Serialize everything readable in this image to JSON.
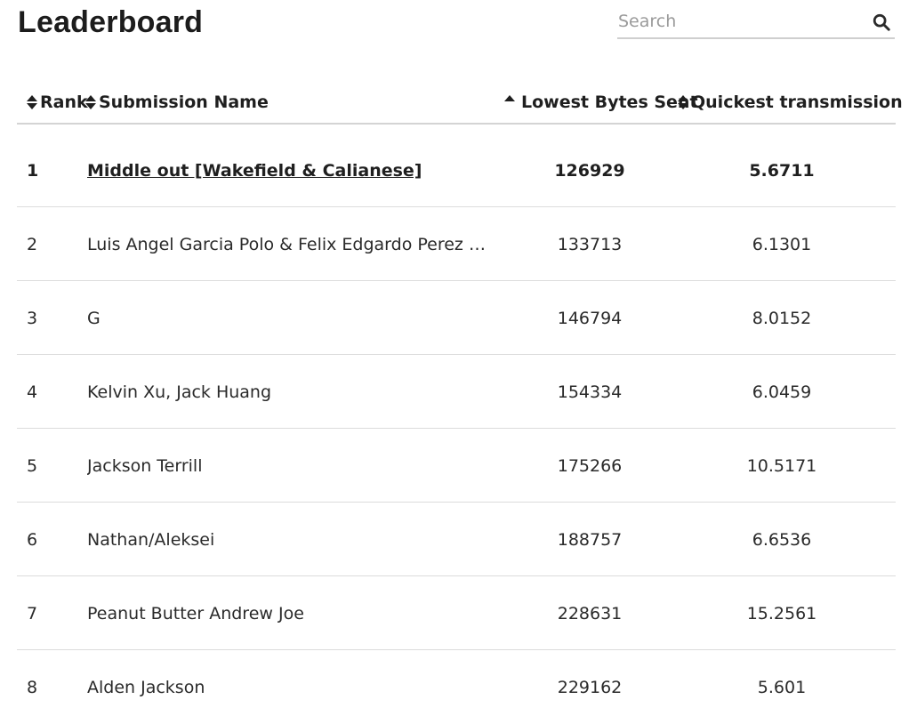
{
  "header": {
    "title": "Leaderboard",
    "search": {
      "placeholder": "Search",
      "value": ""
    }
  },
  "table": {
    "columns": [
      {
        "label": "Rank",
        "sort": "both"
      },
      {
        "label": "Submission Name",
        "sort": "both"
      },
      {
        "label": "Lowest Bytes Sent",
        "sort": "ascending"
      },
      {
        "label": "Quickest transmission",
        "sort": "both"
      }
    ],
    "rows": [
      {
        "rank": "1",
        "name": "Middle out [Wakefield & Calianese]",
        "bytes": "126929",
        "time": "5.6711"
      },
      {
        "rank": "2",
        "name": "Luis Angel Garcia Polo & Felix Edgardo Perez Ma...",
        "bytes": "133713",
        "time": "6.1301"
      },
      {
        "rank": "3",
        "name": "G",
        "bytes": "146794",
        "time": "8.0152"
      },
      {
        "rank": "4",
        "name": "Kelvin Xu, Jack Huang",
        "bytes": "154334",
        "time": "6.0459"
      },
      {
        "rank": "5",
        "name": "Jackson Terrill",
        "bytes": "175266",
        "time": "10.5171"
      },
      {
        "rank": "6",
        "name": "Nathan/Aleksei",
        "bytes": "188757",
        "time": "6.6536"
      },
      {
        "rank": "7",
        "name": "Peanut Butter Andrew Joe",
        "bytes": "228631",
        "time": "15.2561"
      },
      {
        "rank": "8",
        "name": "Alden Jackson",
        "bytes": "229162",
        "time": "5.601"
      }
    ]
  },
  "icons": {
    "search": "search-icon",
    "sort_both": "sort-both-icon",
    "sort_ascending": "sort-ascending-icon"
  },
  "colors": {
    "text": "#262626",
    "divider": "#dcdcdc",
    "placeholder": "#9a9a9a"
  }
}
